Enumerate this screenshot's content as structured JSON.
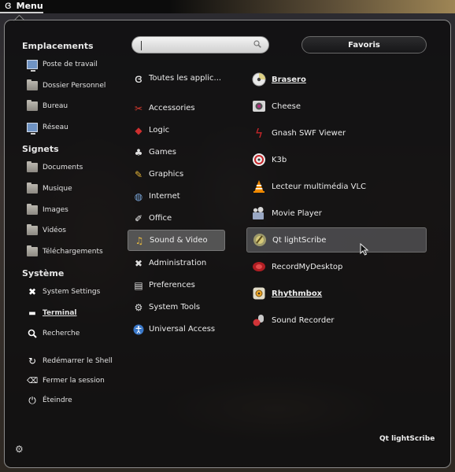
{
  "topbar": {
    "logo_icon": "gnome-foot-icon",
    "menu_label": "Menu"
  },
  "places": {
    "heading": "Emplacements",
    "items": [
      {
        "label": "Poste de travail",
        "icon": "computer-icon"
      },
      {
        "label": "Dossier Personnel",
        "icon": "folder-icon"
      },
      {
        "label": "Bureau",
        "icon": "folder-icon"
      },
      {
        "label": "Réseau",
        "icon": "network-icon"
      }
    ]
  },
  "bookmarks": {
    "heading": "Signets",
    "items": [
      {
        "label": "Documents",
        "icon": "folder-icon"
      },
      {
        "label": "Musique",
        "icon": "folder-icon"
      },
      {
        "label": "Images",
        "icon": "folder-icon"
      },
      {
        "label": "Vidéos",
        "icon": "folder-icon"
      },
      {
        "label": "Téléchargements",
        "icon": "folder-icon"
      }
    ]
  },
  "system": {
    "heading": "Système",
    "items": [
      {
        "label": "System Settings",
        "icon": "tools-icon"
      },
      {
        "label": "Terminal",
        "icon": "terminal-icon"
      },
      {
        "label": "Recherche",
        "icon": "search-icon"
      }
    ]
  },
  "session": {
    "items": [
      {
        "label": "Redémarrer le Shell",
        "icon": "restart-icon"
      },
      {
        "label": "Fermer la session",
        "icon": "logout-icon"
      },
      {
        "label": "Éteindre",
        "icon": "power-icon"
      }
    ]
  },
  "search": {
    "placeholder": ""
  },
  "favorites_button": "Favoris",
  "categories": [
    {
      "label": "Toutes les applic...",
      "icon": "gnome-foot-icon"
    },
    {
      "label": "Accessories",
      "icon": "accessories-icon"
    },
    {
      "label": "Logic",
      "icon": "logic-icon"
    },
    {
      "label": "Games",
      "icon": "games-icon"
    },
    {
      "label": "Graphics",
      "icon": "graphics-icon"
    },
    {
      "label": "Internet",
      "icon": "globe-icon"
    },
    {
      "label": "Office",
      "icon": "office-icon"
    },
    {
      "label": "Sound & Video",
      "icon": "sound-video-icon",
      "selected": true
    },
    {
      "label": "Administration",
      "icon": "administration-icon"
    },
    {
      "label": "Preferences",
      "icon": "preferences-icon"
    },
    {
      "label": "System Tools",
      "icon": "system-tools-icon"
    },
    {
      "label": "Universal Access",
      "icon": "accessibility-icon"
    }
  ],
  "apps": [
    {
      "label": "Brasero",
      "icon": "disc-icon",
      "emphasis": true
    },
    {
      "label": "Cheese",
      "icon": "camera-icon"
    },
    {
      "label": "Gnash SWF Viewer",
      "icon": "flash-icon"
    },
    {
      "label": "K3b",
      "icon": "k3b-icon"
    },
    {
      "label": "Lecteur multimédia VLC",
      "icon": "vlc-cone-icon"
    },
    {
      "label": "Movie Player",
      "icon": "movie-icon"
    },
    {
      "label": "Qt lightScribe",
      "icon": "lightscribe-icon",
      "hovered": true
    },
    {
      "label": "RecordMyDesktop",
      "icon": "record-icon"
    },
    {
      "label": "Rhythmbox",
      "icon": "rhythmbox-icon",
      "emphasis": true
    },
    {
      "label": "Sound Recorder",
      "icon": "microphone-icon"
    }
  ],
  "status_app_name": "Qt lightScribe",
  "colors": {
    "panel_bg": "#0c0c0e",
    "selected_bg": "#5f5f5f",
    "vlc_orange": "#f08a00",
    "flash_red": "#c8262a"
  }
}
